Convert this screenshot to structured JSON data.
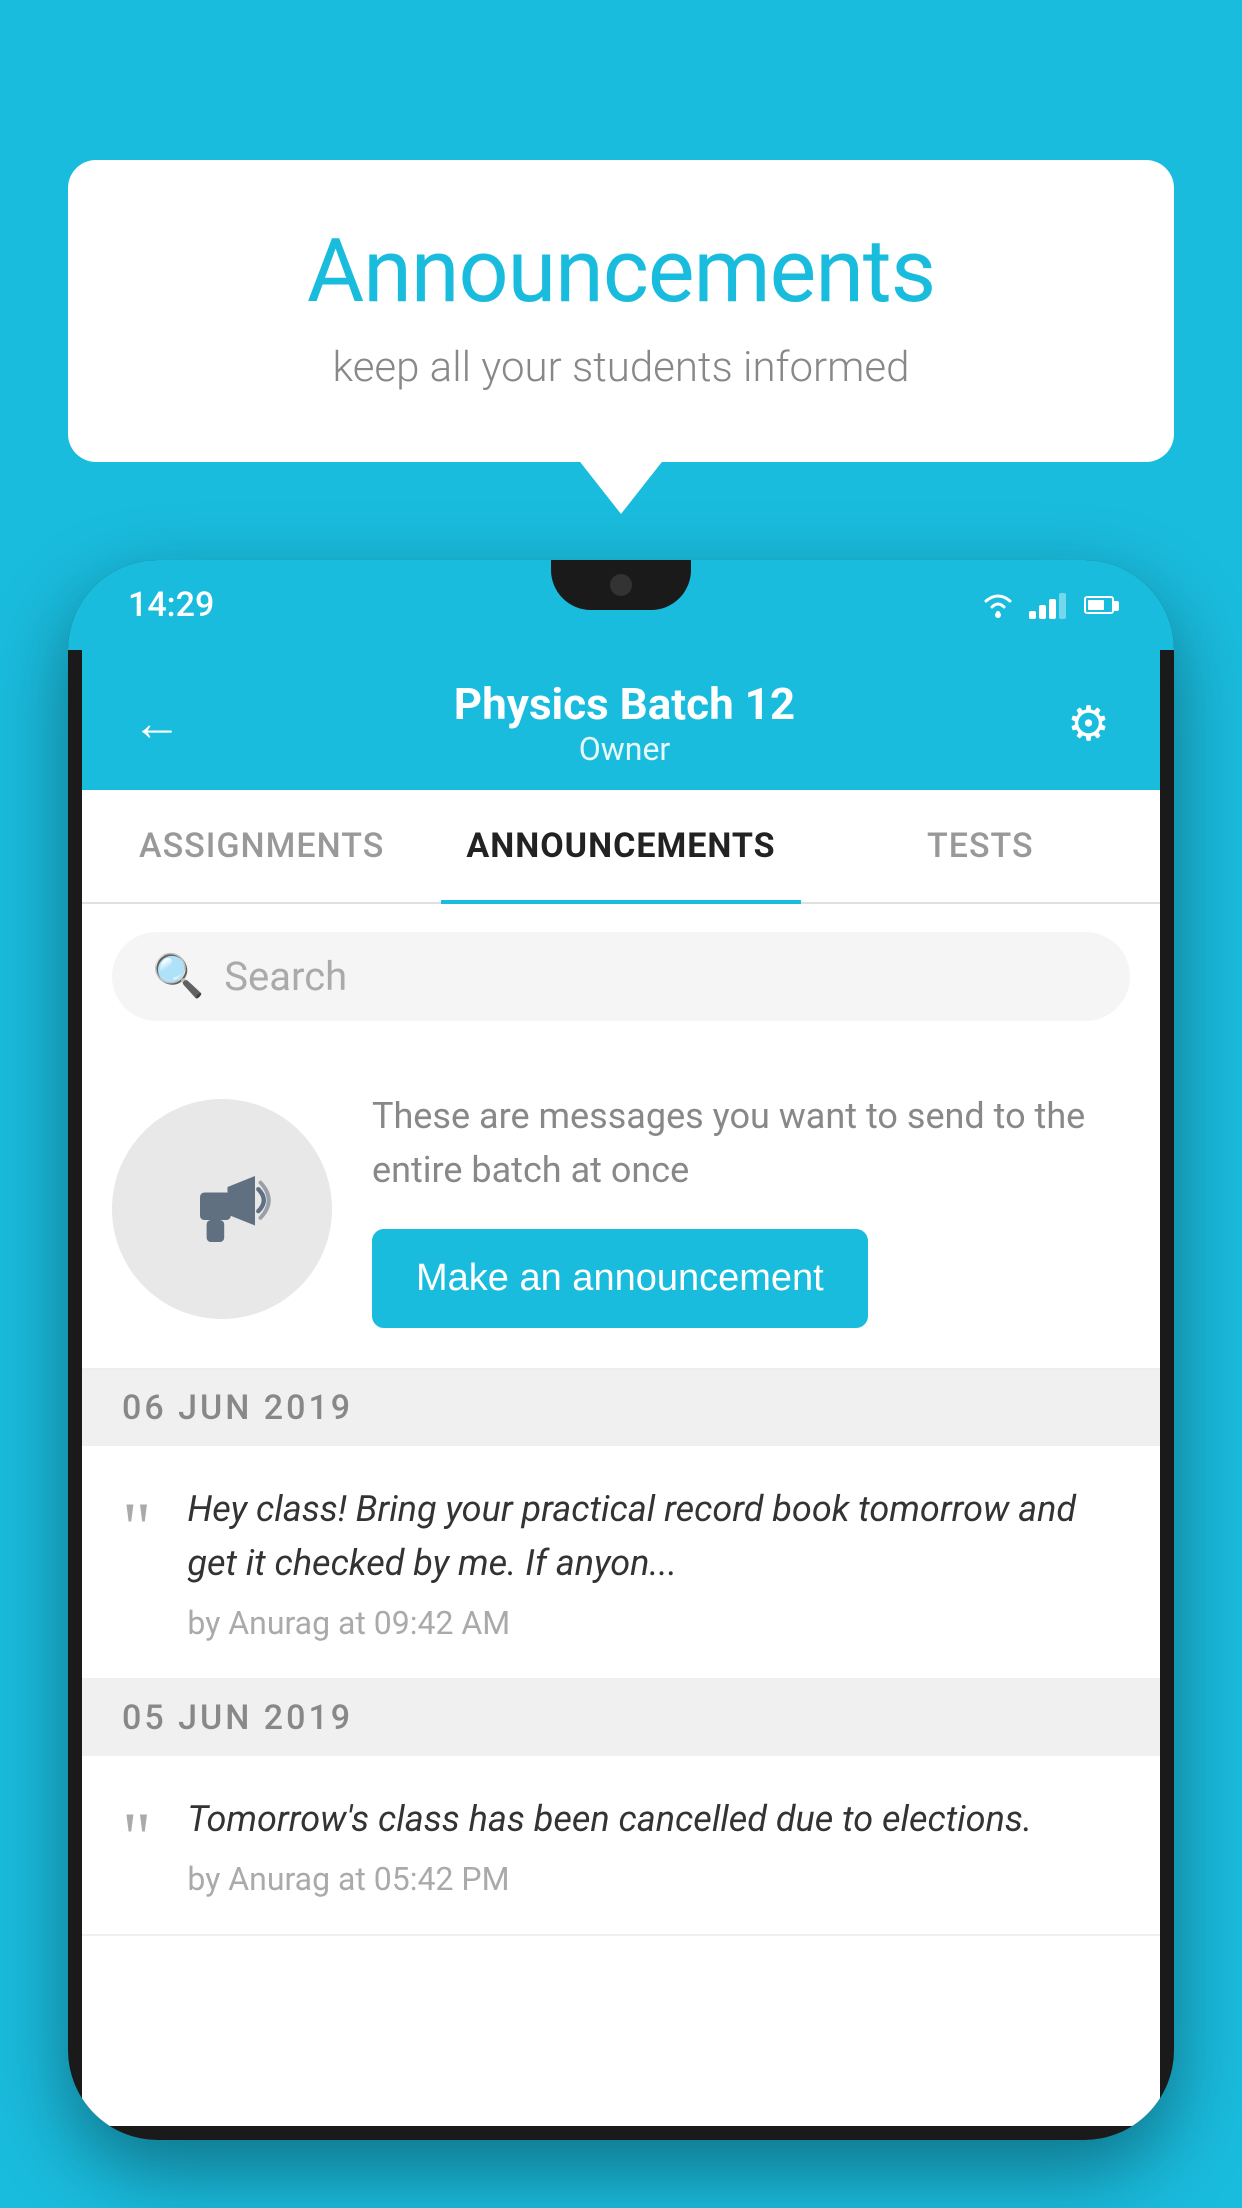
{
  "background_color": "#1ABCDE",
  "speech_bubble": {
    "title": "Announcements",
    "subtitle": "keep all your students informed"
  },
  "phone": {
    "status_bar": {
      "time": "14:29"
    },
    "header": {
      "back_label": "←",
      "title": "Physics Batch 12",
      "subtitle": "Owner",
      "gear_label": "⚙"
    },
    "tabs": [
      {
        "label": "ASSIGNMENTS",
        "active": false
      },
      {
        "label": "ANNOUNCEMENTS",
        "active": true
      },
      {
        "label": "TESTS",
        "active": false
      }
    ],
    "search": {
      "placeholder": "Search"
    },
    "announcement_prompt": {
      "description_text": "These are messages you want to send to the entire batch at once",
      "button_label": "Make an announcement"
    },
    "date_groups": [
      {
        "date": "06  JUN  2019",
        "items": [
          {
            "body": "Hey class! Bring your practical record book tomorrow and get it checked by me. If anyon...",
            "meta": "by Anurag at 09:42 AM"
          }
        ]
      },
      {
        "date": "05  JUN  2019",
        "items": [
          {
            "body": "Tomorrow's class has been cancelled due to elections.",
            "meta": "by Anurag at 05:42 PM"
          }
        ]
      }
    ]
  }
}
